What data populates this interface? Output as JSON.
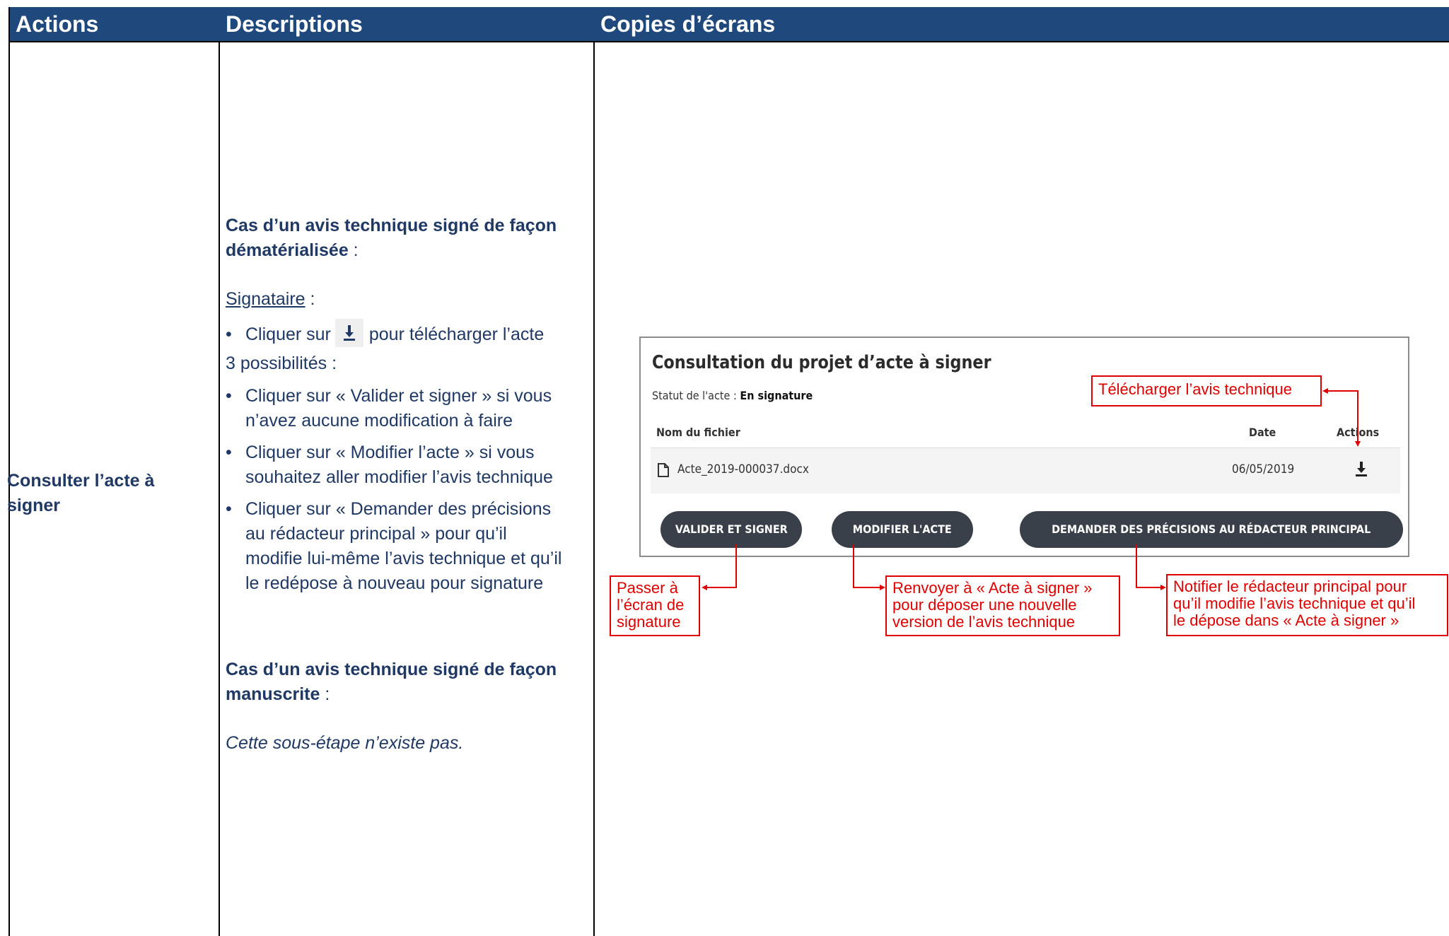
{
  "header": {
    "col_actions": "Actions",
    "col_descriptions": "Descriptions",
    "col_screenshots": "Copies d’écrans"
  },
  "action": {
    "line1": "Consulter l’acte à",
    "line2": "signer"
  },
  "description": {
    "case1_bold_1": "Cas d’un avis technique signé de façon",
    "case1_bold_2": "dématérialisée",
    "colon": " :",
    "signer_label": "Signataire",
    "bullet_glyph": "•",
    "bullet1_before": "Cliquer sur",
    "bullet1_after": "pour télécharger l’acte",
    "possibilities": "3 possibilités :",
    "bullets": [
      [
        "Cliquer sur « Valider et signer » si vous",
        "n’avez aucune modification à faire"
      ],
      [
        "Cliquer sur « Modifier l’acte » si vous",
        "souhaitez aller modifier l’avis technique"
      ],
      [
        "Cliquer sur « Demander des précisions",
        "au rédacteur principal » pour qu’il",
        "modifie lui-même l’avis technique et qu’il",
        "le redépose à nouveau pour signature"
      ]
    ],
    "case2_bold_1": "Cas d’un avis technique signé de façon",
    "case2_bold_2": "manuscrite",
    "case2_note": "Cette sous-étape n’existe pas."
  },
  "screen": {
    "title": "Consultation du projet d’acte à signer",
    "status_label": "Statut de l'acte : ",
    "status_value": "En signature",
    "col_file": "Nom du fichier",
    "col_date": "Date",
    "col_actions": "Actions",
    "file_name": "Acte_2019-000037.docx",
    "file_date": "06/05/2019",
    "btn_validate": "VALIDER ET SIGNER",
    "btn_modify": "MODIFIER L'ACTE",
    "btn_request": "DEMANDER DES PRÉCISIONS AU RÉDACTEUR PRINCIPAL"
  },
  "callouts": {
    "download": "Télécharger l’avis technique",
    "validate": [
      "Passer à",
      "l’écran de",
      "signature"
    ],
    "modify": [
      "Renvoyer à « Acte à signer »",
      "pour déposer une nouvelle",
      "version de l’avis technique"
    ],
    "request": [
      "Notifier le rédacteur principal pour",
      "qu’il modifie l’avis technique et qu’il",
      "le dépose dans « Acte à signer »"
    ]
  },
  "colors": {
    "header_bg": "#1f497d",
    "text_blue": "#1f3864",
    "callout_red": "#e00000",
    "button_dark": "#3a4049"
  }
}
